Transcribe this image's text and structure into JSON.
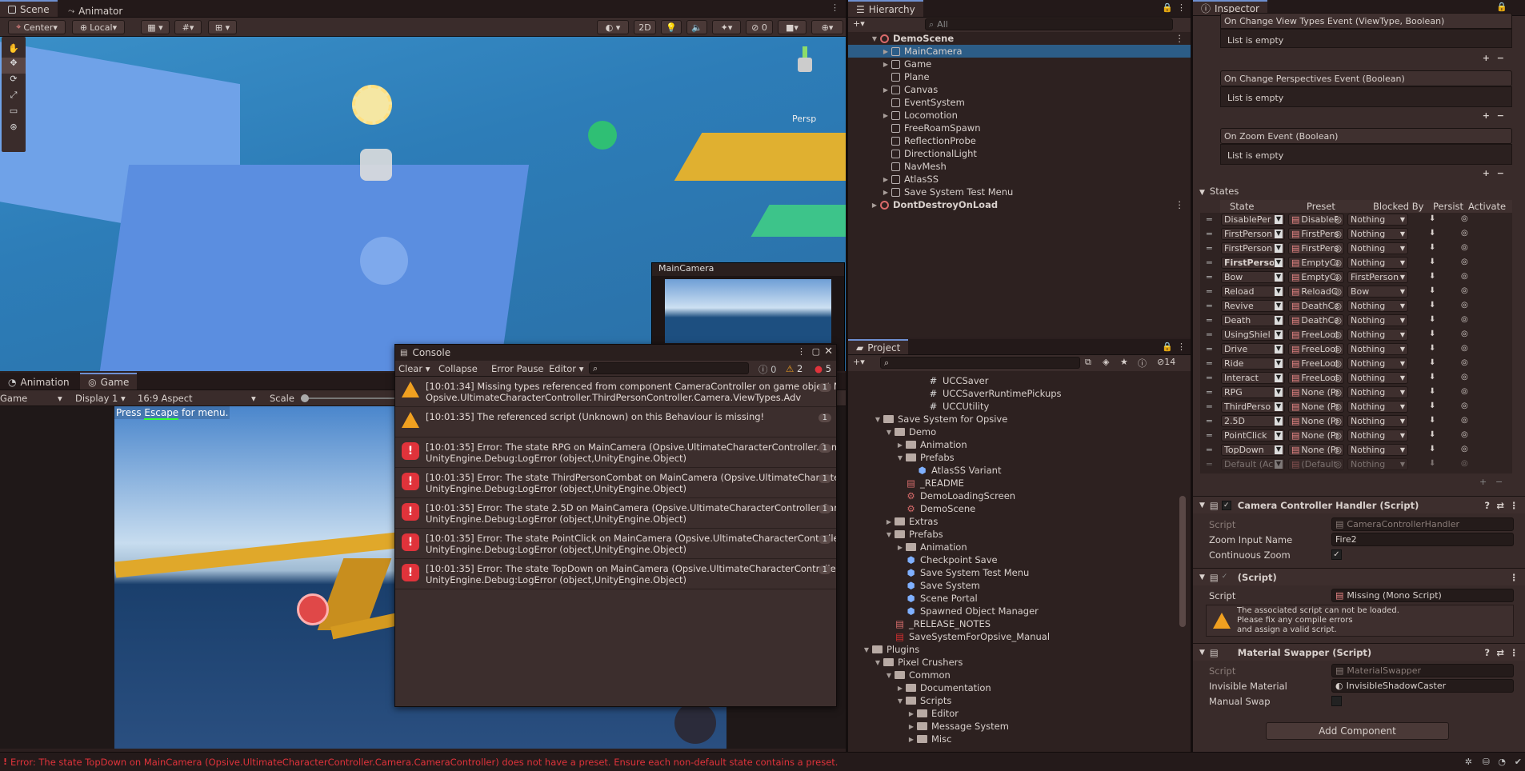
{
  "scene_tabs": {
    "scene": "Scene",
    "animator": "Animator"
  },
  "scene_toolbar": {
    "center": "Center",
    "local": "Local",
    "mode_2d": "2D"
  },
  "scene_view": {
    "persp_label": "Persp",
    "camera_preview_title": "MainCamera"
  },
  "game_tabs": {
    "animation": "Animation",
    "game": "Game"
  },
  "game_toolbar": {
    "game": "Game",
    "display": "Display 1",
    "aspect": "16:9 Aspect",
    "scale": "Scale"
  },
  "game_view": {
    "hint_prefix": "Press ",
    "hint_key": "Escape",
    "hint_suffix": " for menu."
  },
  "console": {
    "title": "Console",
    "clear": "Clear",
    "collapse": "Collapse",
    "error_pause": "Error Pause",
    "editor": "Editor",
    "info_count": "0",
    "warn_count": "2",
    "error_count": "5",
    "logs": [
      {
        "type": "warning",
        "line1": "[10:01:34] Missing types referenced from component CameraController on game object Main",
        "line2": "Opsive.UltimateCharacterController.ThirdPersonController.Camera.ViewTypes.Adv",
        "count": "1"
      },
      {
        "type": "warning",
        "line1": "[10:01:35] The referenced script (Unknown) on this Behaviour is missing!",
        "line2": "",
        "count": "1"
      },
      {
        "type": "error",
        "line1": "[10:01:35] Error: The state RPG on MainCamera (Opsive.UltimateCharacterController.Camer",
        "line2": "UnityEngine.Debug:LogError (object,UnityEngine.Object)",
        "count": "1"
      },
      {
        "type": "error",
        "line1": "[10:01:35] Error: The state ThirdPersonCombat on MainCamera (Opsive.UltimateCharacterC",
        "line2": "UnityEngine.Debug:LogError (object,UnityEngine.Object)",
        "count": "1"
      },
      {
        "type": "error",
        "line1": "[10:01:35] Error: The state 2.5D on MainCamera (Opsive.UltimateCharacterController.Camer",
        "line2": "UnityEngine.Debug:LogError (object,UnityEngine.Object)",
        "count": "1"
      },
      {
        "type": "error",
        "line1": "[10:01:35] Error: The state PointClick on MainCamera (Opsive.UltimateCharacterController.C",
        "line2": "UnityEngine.Debug:LogError (object,UnityEngine.Object)",
        "count": "1"
      },
      {
        "type": "error",
        "line1": "[10:01:35] Error: The state TopDown on MainCamera (Opsive.UltimateCharacterController.C",
        "line2": "UnityEngine.Debug:LogError (object,UnityEngine.Object)",
        "count": "1"
      }
    ]
  },
  "hierarchy": {
    "title": "Hierarchy",
    "search_placeholder": "All",
    "items": [
      {
        "label": "DemoScene",
        "kind": "scene",
        "expand": "open"
      },
      {
        "label": "MainCamera",
        "kind": "go",
        "expand": "closed",
        "selected": true
      },
      {
        "label": "Game",
        "kind": "go",
        "expand": "closed"
      },
      {
        "label": "Plane",
        "kind": "go",
        "expand": "none"
      },
      {
        "label": "Canvas",
        "kind": "go",
        "expand": "closed"
      },
      {
        "label": "EventSystem",
        "kind": "go",
        "expand": "none"
      },
      {
        "label": "Locomotion",
        "kind": "go",
        "expand": "closed"
      },
      {
        "label": "FreeRoamSpawn",
        "kind": "go",
        "expand": "none"
      },
      {
        "label": "ReflectionProbe",
        "kind": "go",
        "expand": "none"
      },
      {
        "label": "DirectionalLight",
        "kind": "go",
        "expand": "none"
      },
      {
        "label": "NavMesh",
        "kind": "go",
        "expand": "none"
      },
      {
        "label": "AtlasSS",
        "kind": "go",
        "expand": "closed"
      },
      {
        "label": "Save System Test Menu",
        "kind": "go",
        "expand": "closed"
      },
      {
        "label": "DontDestroyOnLoad",
        "kind": "scene",
        "expand": "closed"
      }
    ]
  },
  "project": {
    "title": "Project",
    "hidden_count": "14",
    "items": [
      {
        "label": "UCCSaver",
        "kind": "script",
        "expand": "none"
      },
      {
        "label": "UCCSaverRuntimePickups",
        "kind": "script",
        "expand": "none"
      },
      {
        "label": "UCCUtility",
        "kind": "script",
        "expand": "none"
      },
      {
        "label": "Save System for Opsive",
        "kind": "folder",
        "expand": "open"
      },
      {
        "label": "Demo",
        "kind": "folder",
        "expand": "open"
      },
      {
        "label": "Animation",
        "kind": "folder",
        "expand": "closed"
      },
      {
        "label": "Prefabs",
        "kind": "folder",
        "expand": "open"
      },
      {
        "label": "AtlasSS Variant",
        "kind": "prefab",
        "expand": "none"
      },
      {
        "label": "_README",
        "kind": "doc",
        "expand": "none"
      },
      {
        "label": "DemoLoadingScreen",
        "kind": "scene",
        "expand": "none"
      },
      {
        "label": "DemoScene",
        "kind": "scene",
        "expand": "none"
      },
      {
        "label": "Extras",
        "kind": "folder",
        "expand": "closed"
      },
      {
        "label": "Prefabs",
        "kind": "folder",
        "expand": "open"
      },
      {
        "label": "Animation",
        "kind": "folder",
        "expand": "closed"
      },
      {
        "label": "Checkpoint Save",
        "kind": "prefab",
        "expand": "none"
      },
      {
        "label": "Save System Test Menu",
        "kind": "prefab",
        "expand": "none"
      },
      {
        "label": "Save System",
        "kind": "prefab",
        "expand": "none"
      },
      {
        "label": "Scene Portal",
        "kind": "prefab",
        "expand": "none"
      },
      {
        "label": "Spawned Object Manager",
        "kind": "prefab",
        "expand": "none"
      },
      {
        "label": "_RELEASE_NOTES",
        "kind": "doc",
        "expand": "none"
      },
      {
        "label": "SaveSystemForOpsive_Manual",
        "kind": "pdf",
        "expand": "none"
      },
      {
        "label": "Plugins",
        "kind": "folder",
        "expand": "open"
      },
      {
        "label": "Pixel Crushers",
        "kind": "folder",
        "expand": "open"
      },
      {
        "label": "Common",
        "kind": "folder",
        "expand": "open"
      },
      {
        "label": "Documentation",
        "kind": "folder",
        "expand": "closed"
      },
      {
        "label": "Scripts",
        "kind": "folder",
        "expand": "open"
      },
      {
        "label": "Editor",
        "kind": "folder",
        "expand": "closed"
      },
      {
        "label": "Message System",
        "kind": "folder",
        "expand": "closed"
      },
      {
        "label": "Misc",
        "kind": "folder",
        "expand": "closed"
      }
    ]
  },
  "inspector": {
    "title": "Inspector",
    "events": [
      {
        "title": "On Change View Types Event (ViewType, Boolean)",
        "empty": "List is empty"
      },
      {
        "title": "On Change Perspectives Event (Boolean)",
        "empty": "List is empty"
      },
      {
        "title": "On Zoom Event (Boolean)",
        "empty": "List is empty"
      }
    ],
    "states_label": "States",
    "state_headers": {
      "state": "State",
      "preset": "Preset",
      "blocked": "Blocked By",
      "persist": "Persist",
      "activate": "Activate"
    },
    "states": [
      {
        "state": "DisablePer",
        "preset": "DisableP",
        "blocked": "Nothing"
      },
      {
        "state": "FirstPerson",
        "preset": "FirstPers",
        "blocked": "Nothing"
      },
      {
        "state": "FirstPerson",
        "preset": "FirstPers",
        "blocked": "Nothing"
      },
      {
        "state": "FirstPerso",
        "preset": "EmptyCa",
        "blocked": "Nothing"
      },
      {
        "state": "Bow",
        "preset": "EmptyCa",
        "blocked": "FirstPerson"
      },
      {
        "state": "Reload",
        "preset": "ReloadC",
        "blocked": "Bow"
      },
      {
        "state": "Revive",
        "preset": "DeathCa",
        "blocked": "Nothing"
      },
      {
        "state": "Death",
        "preset": "DeathCa",
        "blocked": "Nothing"
      },
      {
        "state": "UsingShiel",
        "preset": "FreeLool",
        "blocked": "Nothing"
      },
      {
        "state": "Drive",
        "preset": "FreeLool",
        "blocked": "Nothing"
      },
      {
        "state": "Ride",
        "preset": "FreeLool",
        "blocked": "Nothing"
      },
      {
        "state": "Interact",
        "preset": "FreeLool",
        "blocked": "Nothing"
      },
      {
        "state": "RPG",
        "preset": "None (Pr",
        "blocked": "Nothing"
      },
      {
        "state": "ThirdPerso",
        "preset": "None (Pr",
        "blocked": "Nothing"
      },
      {
        "state": "2.5D",
        "preset": "None (Pr",
        "blocked": "Nothing"
      },
      {
        "state": "PointClick",
        "preset": "None (Pr",
        "blocked": "Nothing"
      },
      {
        "state": "TopDown",
        "preset": "None (Pr",
        "blocked": "Nothing"
      },
      {
        "state": "Default (Ac",
        "preset": "(Default",
        "blocked": "Nothing"
      }
    ],
    "cch": {
      "title": "Camera Controller Handler (Script)",
      "script_label": "Script",
      "script_value": "CameraControllerHandler",
      "zoom_label": "Zoom Input Name",
      "zoom_value": "Fire2",
      "cont_label": "Continuous Zoom"
    },
    "missing": {
      "title": "(Script)",
      "script_label": "Script",
      "script_value": "Missing (Mono Script)",
      "warning": "The associated script can not be loaded.\nPlease fix any compile errors\nand assign a valid script."
    },
    "ms": {
      "title": "Material Swapper (Script)",
      "script_label": "Script",
      "script_value": "MaterialSwapper",
      "inv_label": "Invisible Material",
      "inv_value": "InvisibleShadowCaster",
      "manual_label": "Manual Swap"
    },
    "add_component": "Add Component"
  },
  "status_bar": {
    "message": "Error: The state TopDown on MainCamera (Opsive.UltimateCharacterController.Camera.CameraController) does not have a preset. Ensure each non-default state contains a preset."
  }
}
